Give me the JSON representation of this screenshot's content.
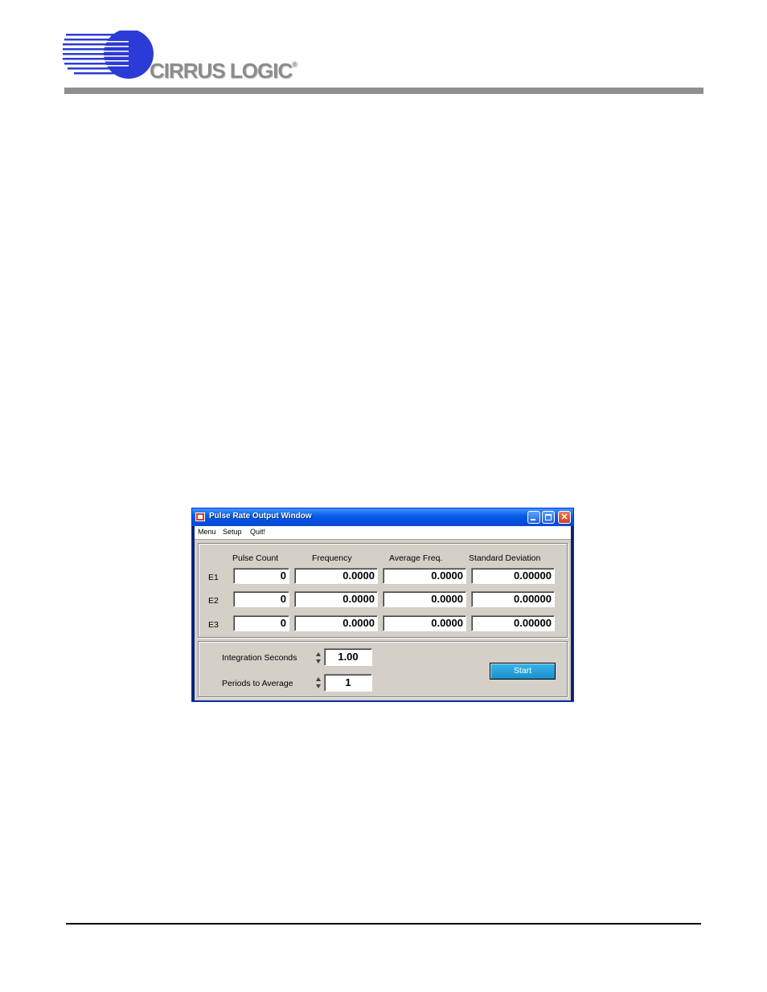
{
  "brand": {
    "logo_text": "CIRRUS LOGIC",
    "registered_mark": "®",
    "logo_color": "#2b3bd6",
    "header_bar_color": "#8f8f8f"
  },
  "window": {
    "title": "Pulse Rate Output Window",
    "controls": {
      "minimize": "",
      "maximize": "",
      "close": "✕"
    },
    "menu": [
      "Menu",
      "Setup",
      "Quit!"
    ],
    "table": {
      "columns": [
        "Pulse Count",
        "Frequency",
        "Average Freq.",
        "Standard Deviation"
      ],
      "rows": [
        {
          "label": "E1",
          "values": [
            "0",
            "0.0000",
            "0.0000",
            "0.00000"
          ]
        },
        {
          "label": "E2",
          "values": [
            "0",
            "0.0000",
            "0.0000",
            "0.00000"
          ]
        },
        {
          "label": "E3",
          "values": [
            "0",
            "0.0000",
            "0.0000",
            "0.00000"
          ]
        }
      ]
    },
    "integration": {
      "label": "Integration Seconds",
      "value": "1.00"
    },
    "periods": {
      "label": "Periods to Average",
      "value": "1"
    },
    "start_label": "Start",
    "colors": {
      "titlebar": "#0a5fe8",
      "start_button": "#1a8fcc",
      "client_bg": "#d4d0c8"
    }
  }
}
